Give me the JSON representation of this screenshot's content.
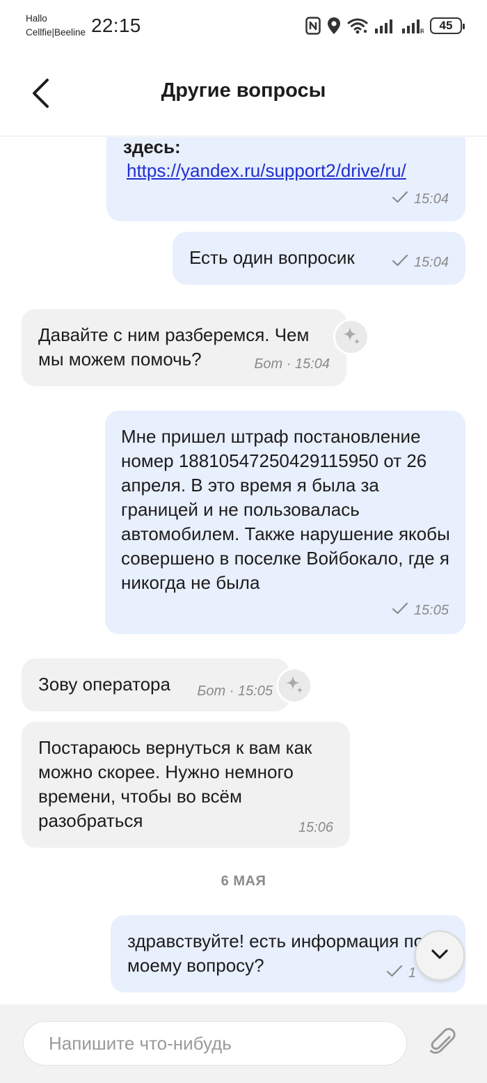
{
  "status_bar": {
    "carrier_line1": "Hallo",
    "carrier_line2": "Cellfie|Beeline",
    "time": "22:15",
    "battery": "45",
    "icons": [
      "nfc-icon",
      "location-icon",
      "wifi-icon",
      "signal-icon",
      "signal-roaming-icon",
      "battery-icon"
    ]
  },
  "header": {
    "title": "Другие вопросы",
    "back_icon": "chevron-left-icon"
  },
  "messages": [
    {
      "direction": "outgoing",
      "text_bold": "здесь:",
      "link": "https://yandex.ru/support2/drive/ru/",
      "time": "15:04",
      "status": "sent"
    },
    {
      "direction": "outgoing",
      "text": "Есть один вопросик",
      "time": "15:04",
      "status": "sent"
    },
    {
      "direction": "incoming",
      "text": "Давайте с ним разберемся. Чем мы можем помочь?",
      "sender": "Бот",
      "time": "15:04",
      "icon": "sparkle-icon"
    },
    {
      "direction": "outgoing",
      "text": "Мне пришел штраф постановление номер 18810547250429115950 от 26 апреля. В это время я была за границей и не пользовалась автомобилем.  Также нарушение якобы совершено в поселке Войбокало, где я никогда не была",
      "time": "15:05",
      "status": "sent"
    },
    {
      "direction": "incoming",
      "text": "Зову оператора",
      "sender": "Бот",
      "time": "15:05",
      "icon": "sparkle-icon"
    },
    {
      "direction": "incoming",
      "text": "Постараюсь вернуться к вам как можно скорее. Нужно немного времени, чтобы во всём разобраться",
      "time": "15:06"
    },
    {
      "direction": "outgoing",
      "text": "здравствуйте! есть информация по моему вопросу?",
      "time": "1",
      "status": "sent"
    }
  ],
  "date_separator": "6 МАЯ",
  "bot_meta": {
    "m3": "Бот · 15:04",
    "m5": "Бот · 15:05"
  },
  "input": {
    "placeholder": "Напишите что-нибудь",
    "value": "",
    "attach_icon": "paperclip-icon"
  },
  "scroll_down_icon": "chevron-down-icon",
  "colors": {
    "outgoing_bubble": "#e8effd",
    "incoming_bubble": "#f1f1f1",
    "link": "#1f2fd1",
    "meta_text": "#8a8a8a",
    "input_bar_bg": "#f2f2f2"
  }
}
